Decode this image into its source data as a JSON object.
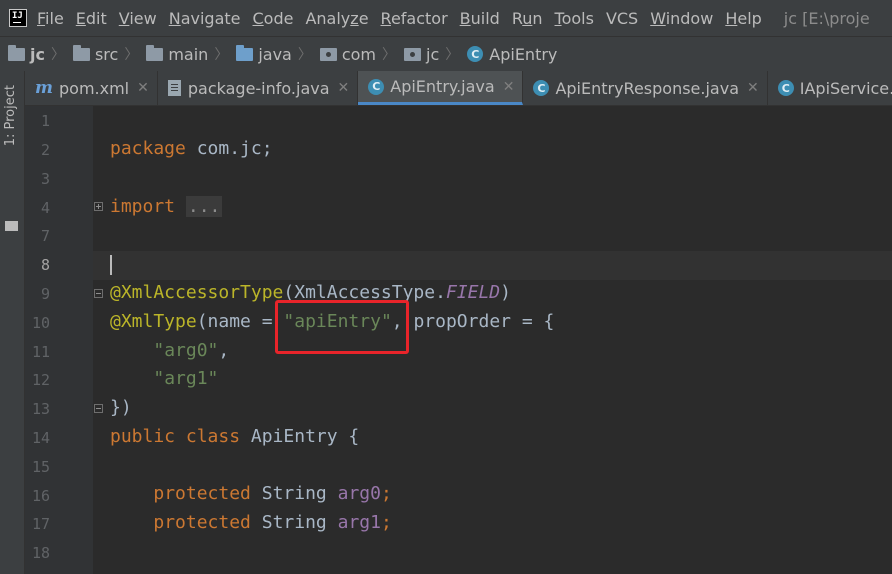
{
  "menubar": {
    "items": [
      "File",
      "Edit",
      "View",
      "Navigate",
      "Code",
      "Analyze",
      "Refactor",
      "Build",
      "Run",
      "Tools",
      "VCS",
      "Window",
      "Help"
    ],
    "mnemonics": [
      "F",
      "E",
      "V",
      "N",
      "C",
      "z",
      "R",
      "B",
      "u",
      "T",
      "",
      "W",
      "H"
    ],
    "window_title": "jc [E:\\proje"
  },
  "breadcrumb": {
    "items": [
      "jc",
      "src",
      "main",
      "java",
      "com",
      "jc",
      "ApiEntry"
    ]
  },
  "sidebar": {
    "project_label": "1: Project"
  },
  "tabs": [
    {
      "label": "pom.xml",
      "icon": "maven-icon"
    },
    {
      "label": "package-info.java",
      "icon": "file-icon"
    },
    {
      "label": "ApiEntry.java",
      "icon": "class-icon",
      "active": true
    },
    {
      "label": "ApiEntryResponse.java",
      "icon": "class-icon"
    },
    {
      "label": "IApiService.java",
      "icon": "class-icon"
    }
  ],
  "editor": {
    "line_numbers": [
      "1",
      "2",
      "3",
      "4",
      "7",
      "8",
      "9",
      "10",
      "11",
      "12",
      "13",
      "14",
      "15",
      "16",
      "17",
      "18"
    ],
    "code": {
      "package_kw": "package",
      "package_name": " com.jc;",
      "import_kw": "import",
      "import_folded": "...",
      "ann1": "@XmlAccessorType",
      "ann1_rest_a": "(XmlAccessType.",
      "ann1_const": "FIELD",
      "ann1_rest_b": ")",
      "ann2": "@XmlType",
      "ann2_rest_a": "(name = ",
      "ann2_str": "\"apiEntry\"",
      "ann2_rest_b": ", propOrder = {",
      "arg0": "\"arg0\"",
      "arg1": "\"arg1\"",
      "comma": ",",
      "close": "})",
      "class_kw": "public class",
      "class_name": " ApiEntry {",
      "protected_kw": "protected",
      "string_type": " String ",
      "field0": "arg0",
      "field1": "arg1",
      "semicolon": ";"
    }
  },
  "colors": {
    "keyword": "#cc7832",
    "annotation": "#bbb529",
    "string": "#6a8759",
    "constant": "#9876aa",
    "highlight_box": "#e8242a"
  }
}
